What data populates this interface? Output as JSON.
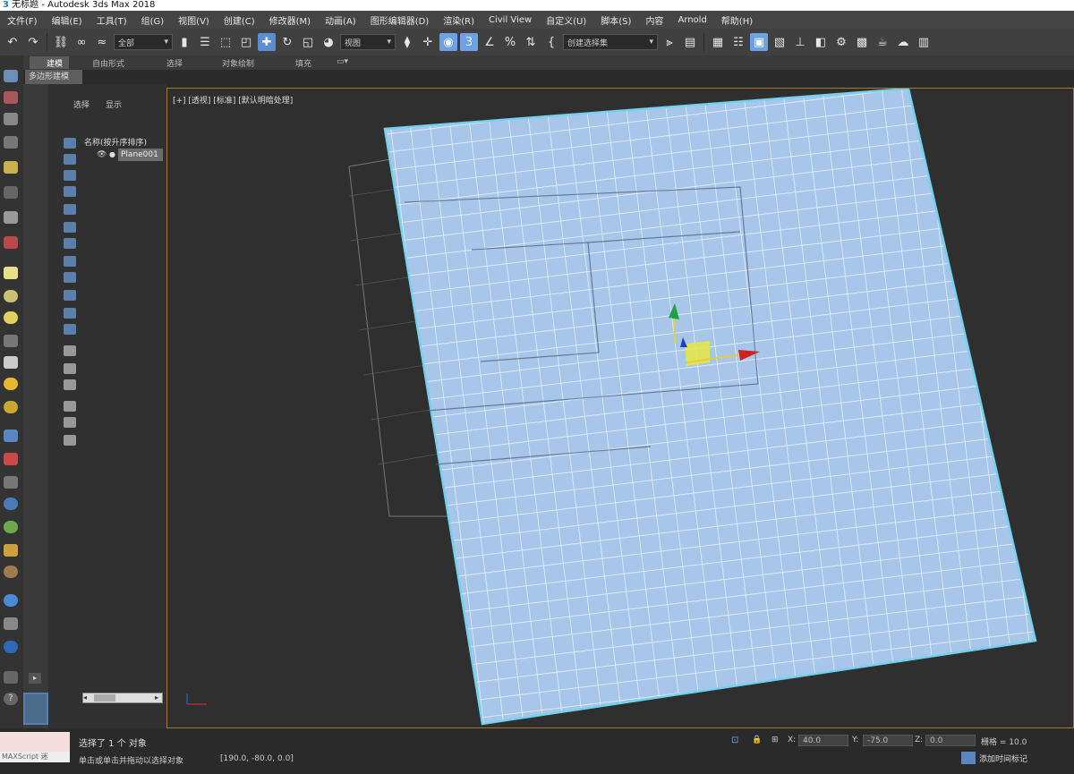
{
  "window": {
    "title": "无标题 - Autodesk 3ds Max 2018"
  },
  "menu": [
    "文件(F)",
    "编辑(E)",
    "工具(T)",
    "组(G)",
    "视图(V)",
    "创建(C)",
    "修改器(M)",
    "动画(A)",
    "图形编辑器(D)",
    "渲染(R)",
    "Civil View",
    "自定义(U)",
    "脚本(S)",
    "内容",
    "Arnold",
    "帮助(H)"
  ],
  "toolbar": {
    "selection_filter": "全部",
    "ref_coord": "视图",
    "named_selection": "创建选择集"
  },
  "ribbon": {
    "tabs": [
      "建模",
      "自由形式",
      "选择",
      "对象绘制",
      "填充"
    ],
    "active_tab": "建模",
    "sub_panel": "多边形建模"
  },
  "explorer": {
    "tabs": [
      "选择",
      "显示"
    ],
    "header": "名称(按升序排序)",
    "items": [
      {
        "name": "Plane001"
      }
    ]
  },
  "viewport": {
    "labels": "[+] [透视] [标准] [默认明暗处理]"
  },
  "status": {
    "selected": "选择了 1 个 对象",
    "maxscript": "MAXScript 迷",
    "hint": "单击或单击并拖动以选择对象",
    "coords": "[190.0, -80.0, 0.0]",
    "x_value": "40.0",
    "y_value": "-75.0",
    "z_value": "0.0",
    "grid": "栅格 = 10.0",
    "autokey": "添加时间标记"
  },
  "colors": {
    "accent": "#5a8fd6",
    "mesh_fill": "#a7c6ea",
    "mesh_edge": "#74d2ec",
    "viewport_border": "#a07a2a"
  }
}
